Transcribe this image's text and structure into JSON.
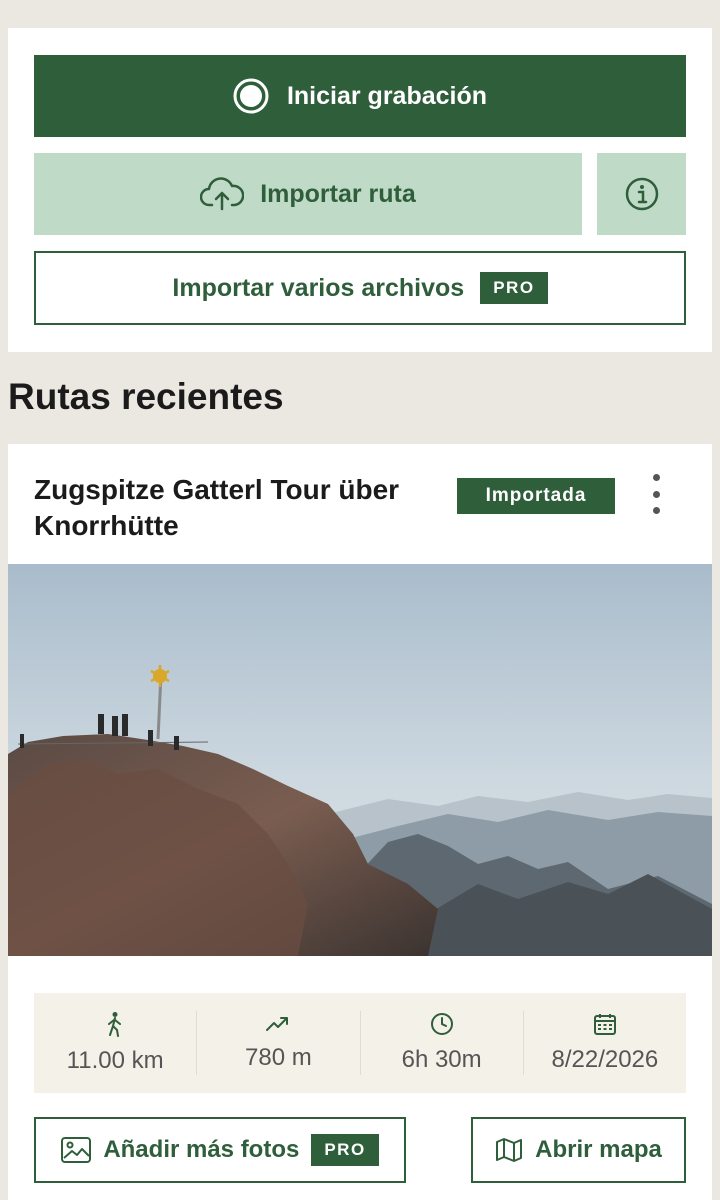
{
  "actions": {
    "record_label": "Iniciar grabación",
    "import_label": "Importar ruta",
    "import_multi_label": "Importar varios archivos",
    "pro_badge": "PRO"
  },
  "section": {
    "title": "Rutas recientes"
  },
  "route": {
    "title": "Zugspitze Gatterl Tour über Knorrhütte",
    "status_badge": "Importada",
    "stats": [
      {
        "icon": "walking-icon",
        "value": "11.00 km"
      },
      {
        "icon": "trending-up-icon",
        "value": "780 m"
      },
      {
        "icon": "clock-icon",
        "value": "6h 30m"
      },
      {
        "icon": "calendar-icon",
        "value": "8/22/2026"
      }
    ],
    "add_photos_label": "Añadir más fotos",
    "open_map_label": "Abrir mapa"
  },
  "colors": {
    "primary": "#2f5e3b",
    "light_primary": "#c0dac8",
    "background": "#ebe8e1",
    "stats_background": "#f4f1e8"
  }
}
